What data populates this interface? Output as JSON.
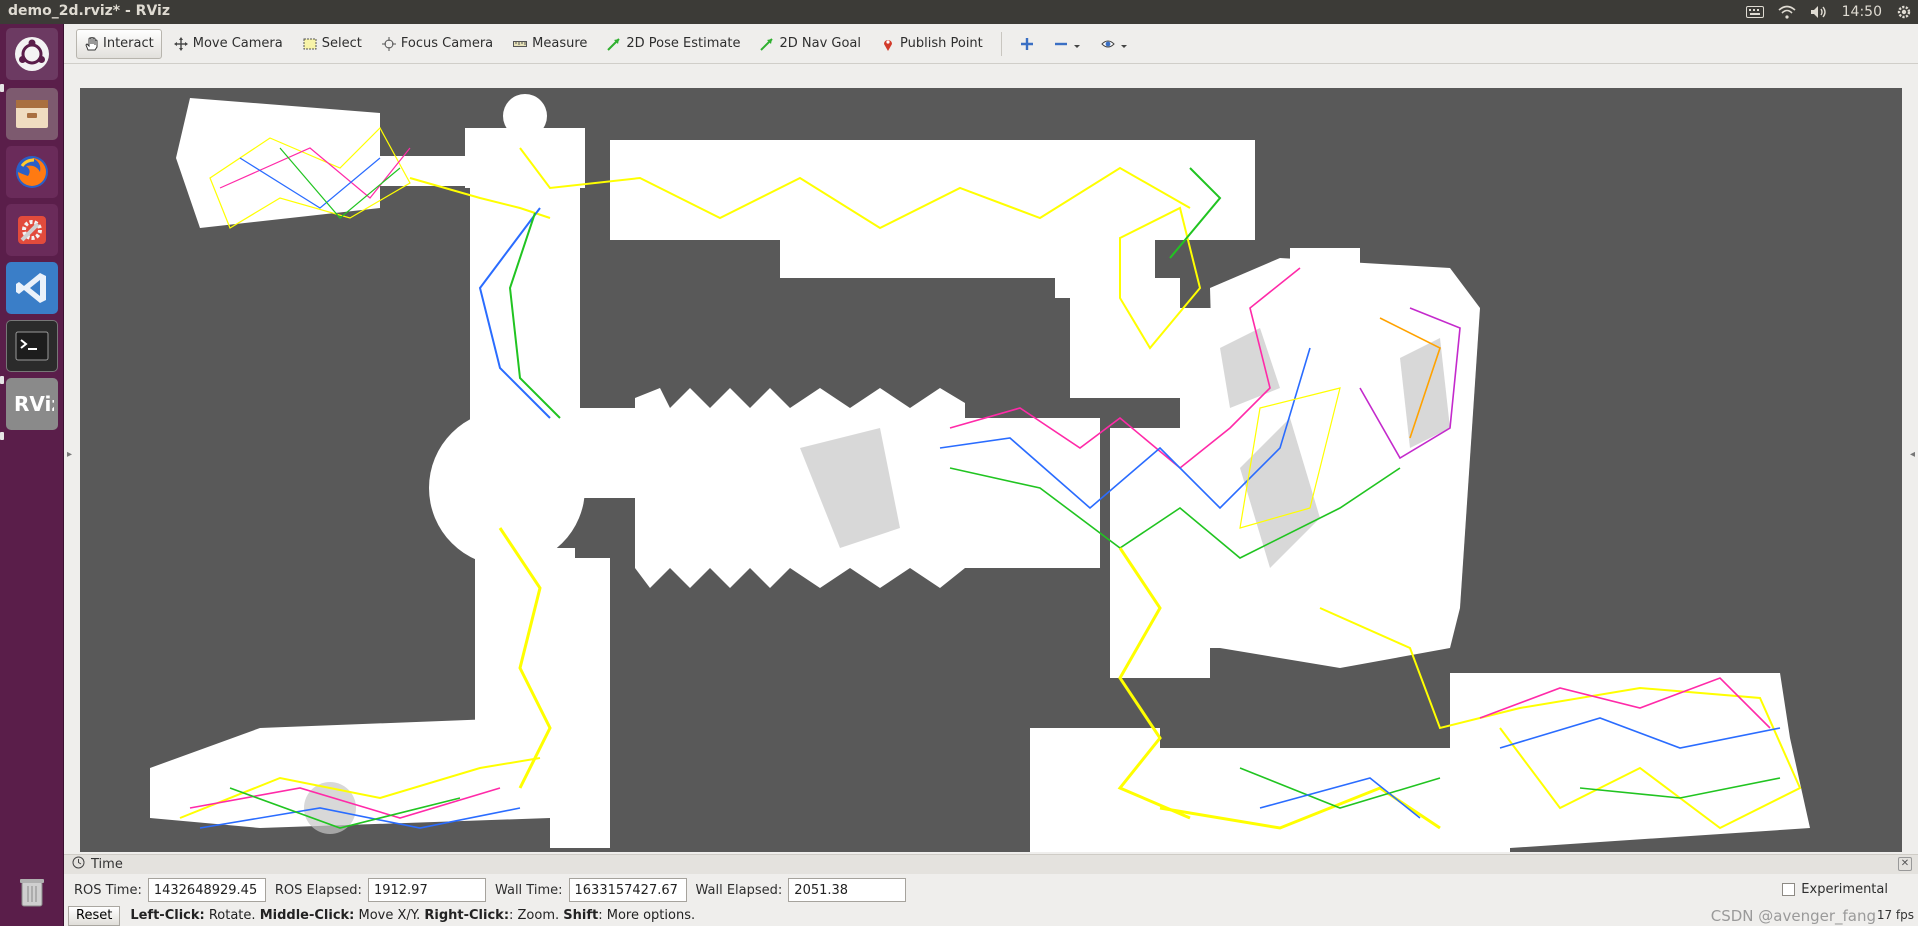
{
  "system": {
    "window_title": "demo_2d.rviz* - RViz",
    "clock": "14:50"
  },
  "launcher": {
    "items": [
      {
        "name": "ubuntu-dash-icon"
      },
      {
        "name": "files-icon"
      },
      {
        "name": "firefox-icon"
      },
      {
        "name": "system-settings-icon"
      },
      {
        "name": "vscode-icon"
      },
      {
        "name": "terminal-icon"
      },
      {
        "name": "rviz-icon"
      },
      {
        "name": "trash-icon"
      }
    ]
  },
  "toolbar": {
    "interact": "Interact",
    "move_camera": "Move Camera",
    "select": "Select",
    "focus_camera": "Focus Camera",
    "measure": "Measure",
    "pose_estimate": "2D Pose Estimate",
    "nav_goal": "2D Nav Goal",
    "publish_point": "Publish Point"
  },
  "time_panel": {
    "title": "Time",
    "ros_time_label": "ROS Time:",
    "ros_time_value": "1432648929.45",
    "ros_elapsed_label": "ROS Elapsed:",
    "ros_elapsed_value": "1912.97",
    "wall_time_label": "Wall Time:",
    "wall_time_value": "1633157427.67",
    "wall_elapsed_label": "Wall Elapsed:",
    "wall_elapsed_value": "2051.38",
    "experimental_label": "Experimental"
  },
  "status_bar": {
    "reset_label": "Reset",
    "left_click_key": "Left-Click:",
    "left_click_text": "Rotate.",
    "middle_click_key": "Middle-Click:",
    "middle_click_text": "Move X/Y.",
    "right_click_key": "Right-Click:",
    "right_click_text": ": Zoom.",
    "shift_key": "Shift",
    "shift_text": ": More options.",
    "fps": "17 fps",
    "watermark": "CSDN @avenger_fang"
  },
  "colors": {
    "map_background": "#595959",
    "free_space": "#ffffff",
    "trajectory_main": "#ffff00",
    "launcher_bg": "#5a1e4a"
  }
}
